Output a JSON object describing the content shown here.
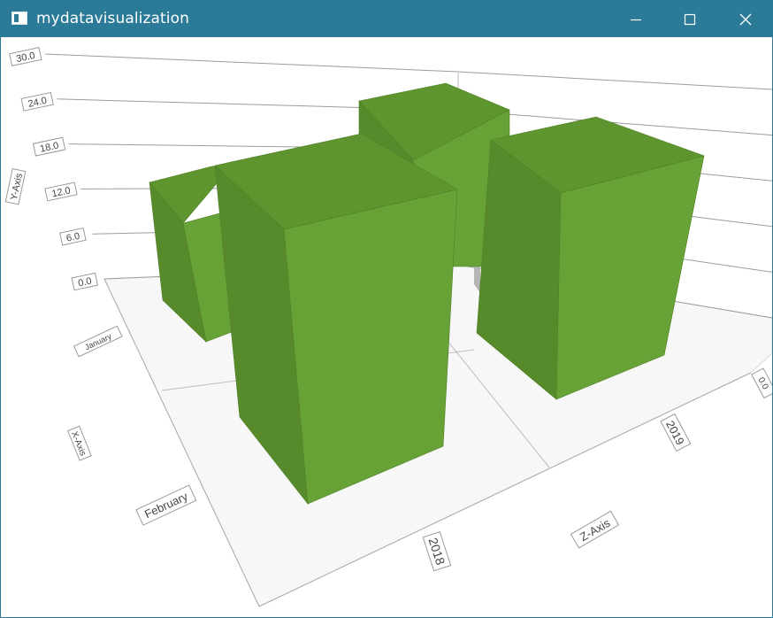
{
  "window": {
    "title": "mydatavisualization",
    "icons": {
      "app": "app-window-icon",
      "minimize": "minimize-icon",
      "maximize": "maximize-icon",
      "close": "close-icon"
    },
    "titlebar_color": "#2b7a97"
  },
  "chart_data": {
    "type": "bar3d",
    "bar_color": "#66a136",
    "y_axis": {
      "label": "Y-Axis",
      "ticks": [
        "0.0",
        "6.0",
        "12.0",
        "18.0",
        "24.0",
        "30.0"
      ],
      "range": [
        0,
        30
      ]
    },
    "x_axis": {
      "label": "X-Axis",
      "categories": [
        "January",
        "February"
      ]
    },
    "z_axis": {
      "label": "Z-Axis",
      "categories": [
        "2018",
        "2019"
      ]
    },
    "side_tick": "0.0",
    "grid": true,
    "series": [
      {
        "x": "January",
        "z": "2018",
        "y": 18
      },
      {
        "x": "January",
        "z": "2019",
        "y": 24
      },
      {
        "x": "February",
        "z": "2018",
        "y": 30
      },
      {
        "x": "February",
        "z": "2019",
        "y": 27
      }
    ]
  }
}
